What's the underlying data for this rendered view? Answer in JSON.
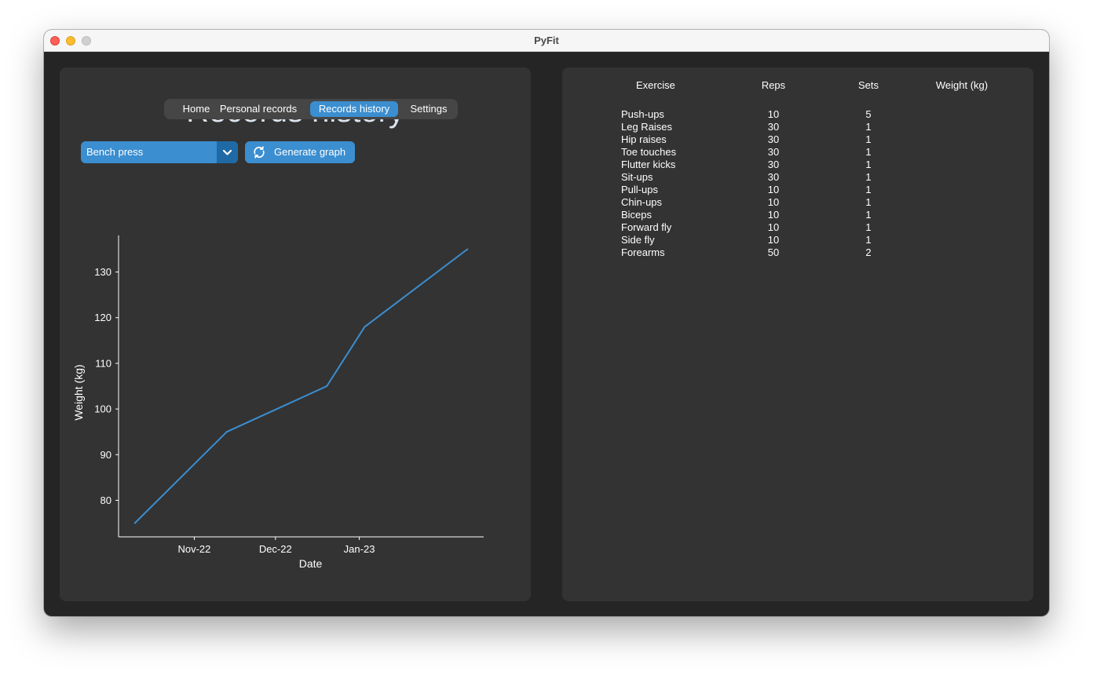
{
  "window": {
    "title": "PyFit"
  },
  "tabs": [
    {
      "label": "Home",
      "active": false
    },
    {
      "label": "Personal records",
      "active": false
    },
    {
      "label": "Records history",
      "active": true
    },
    {
      "label": "Settings",
      "active": false
    }
  ],
  "page_title": "Records history",
  "exercise_select": {
    "value": "Bench press",
    "icon": "chevron-down-icon"
  },
  "generate_button": {
    "label": "Generate graph",
    "icon": "refresh-icon"
  },
  "colors": {
    "accent": "#3b8ed0",
    "accent_dark": "#1f6aa5",
    "panel": "#333333",
    "window_bg": "#252525",
    "line": "#3b8ed0"
  },
  "chart_data": {
    "type": "line",
    "title": "",
    "xlabel": "Date",
    "ylabel": "Weight (kg)",
    "x": [
      "2022-10-10",
      "2022-11-13",
      "2022-12-20",
      "2023-01-03",
      "2023-02-10"
    ],
    "values": [
      75,
      95,
      105,
      118,
      135
    ],
    "xlim": [
      "2022-10-04",
      "2023-02-16"
    ],
    "ylim": [
      72,
      138
    ],
    "x_ticks": [
      {
        "date": "2022-11-01",
        "label": "Nov-22"
      },
      {
        "date": "2022-12-01",
        "label": "Dec-22"
      },
      {
        "date": "2023-01-01",
        "label": "Jan-23"
      }
    ],
    "y_ticks": [
      80,
      90,
      100,
      110,
      120,
      130
    ],
    "grid": false,
    "legend": "none"
  },
  "table": {
    "headers": {
      "exercise": "Exercise",
      "reps": "Reps",
      "sets": "Sets",
      "weight": "Weight (kg)"
    },
    "rows": [
      {
        "exercise": "Push-ups",
        "reps": "10",
        "sets": "5",
        "weight": ""
      },
      {
        "exercise": "Leg Raises",
        "reps": "30",
        "sets": "1",
        "weight": ""
      },
      {
        "exercise": "Hip raises",
        "reps": "30",
        "sets": "1",
        "weight": ""
      },
      {
        "exercise": "Toe touches",
        "reps": "30",
        "sets": "1",
        "weight": ""
      },
      {
        "exercise": "Flutter kicks",
        "reps": "30",
        "sets": "1",
        "weight": ""
      },
      {
        "exercise": "Sit-ups",
        "reps": "30",
        "sets": "1",
        "weight": ""
      },
      {
        "exercise": "Pull-ups",
        "reps": "10",
        "sets": "1",
        "weight": ""
      },
      {
        "exercise": "Chin-ups",
        "reps": "10",
        "sets": "1",
        "weight": ""
      },
      {
        "exercise": "Biceps",
        "reps": "10",
        "sets": "1",
        "weight": ""
      },
      {
        "exercise": "Forward fly",
        "reps": "10",
        "sets": "1",
        "weight": ""
      },
      {
        "exercise": "Side fly",
        "reps": "10",
        "sets": "1",
        "weight": ""
      },
      {
        "exercise": "Forearms",
        "reps": "50",
        "sets": "2",
        "weight": ""
      }
    ]
  }
}
